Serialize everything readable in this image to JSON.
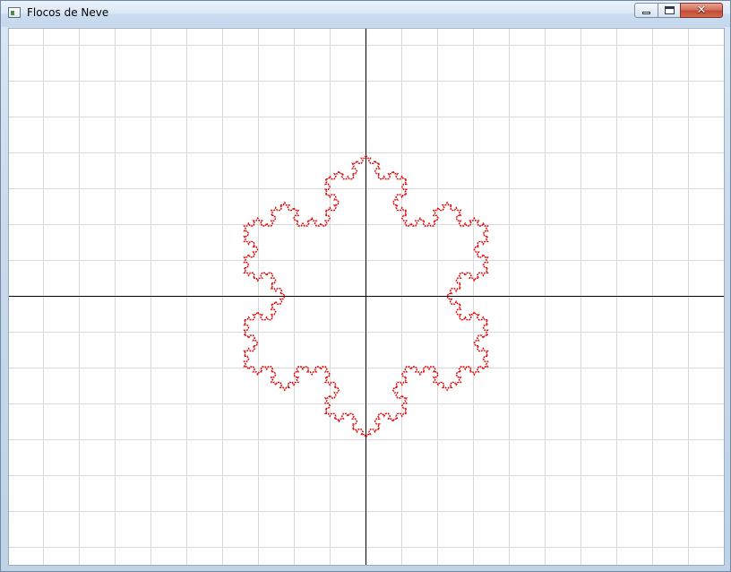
{
  "window": {
    "title": "Flocos de Neve",
    "app_icon": "window-app-icon",
    "controls": {
      "minimize_icon": "minimize-icon",
      "maximize_icon": "maximize-icon",
      "close_label": "✕"
    }
  },
  "canvas": {
    "background": "#ffffff",
    "grid_color": "#d8d8d8",
    "axis_color": "#000000",
    "curve_color": "#e00000",
    "grid": true,
    "x_axis": true,
    "y_axis": true,
    "figure": "Koch snowflake outline",
    "iteration_depth": 4
  }
}
